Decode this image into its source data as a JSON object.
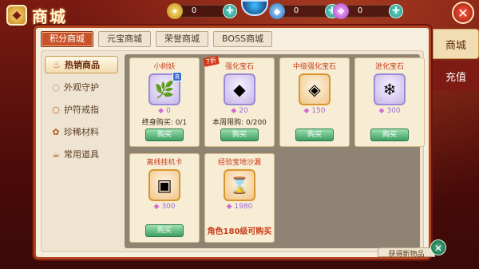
{
  "title": "商城",
  "currencies": [
    {
      "name": "gold-coin",
      "value": "0"
    },
    {
      "name": "blue-gem",
      "value": "0"
    },
    {
      "name": "purple-crystal",
      "value": "0"
    }
  ],
  "tabs": [
    "积分商城",
    "元宝商城",
    "荣誉商城",
    "BOSS商城"
  ],
  "sidebar": [
    {
      "label": "热销商品",
      "icon": "fire-icon"
    },
    {
      "label": "外观守护",
      "icon": "shield-icon"
    },
    {
      "label": "护符戒指",
      "icon": "ring-icon"
    },
    {
      "label": "珍稀材料",
      "icon": "material-icon"
    },
    {
      "label": "常用道具",
      "icon": "tool-icon"
    }
  ],
  "items": [
    {
      "name": "小树妖",
      "price": "0",
      "limit": "终身购买: 0/1",
      "buy": "购买",
      "icon": "tree-spirit-icon",
      "tag": "",
      "badge": "R"
    },
    {
      "name": "强化宝石",
      "price": "20",
      "limit": "本周限购: 0/200",
      "buy": "购买",
      "icon": "purple-gem-icon",
      "tag": "7折",
      "badge": ""
    },
    {
      "name": "中级强化宝石",
      "price": "150",
      "limit": "",
      "buy": "购买",
      "icon": "orange-gem-icon",
      "tag": "",
      "badge": ""
    },
    {
      "name": "进化宝石",
      "price": "300",
      "limit": "",
      "buy": "购买",
      "icon": "blue-crystal-icon",
      "tag": "",
      "badge": ""
    },
    {
      "name": "离线挂机卡",
      "price": "300",
      "limit": "",
      "buy": "购买",
      "icon": "red-card-icon",
      "tag": "",
      "badge": ""
    },
    {
      "name": "经验宝地沙漏",
      "price": "1980",
      "limit": "",
      "buy": "",
      "icon": "hourglass-icon",
      "tag": "",
      "badge": "",
      "footer": "角色180级可购买"
    }
  ],
  "right_tabs": [
    "商城",
    "充值"
  ],
  "bottom_button": "获得新物品"
}
